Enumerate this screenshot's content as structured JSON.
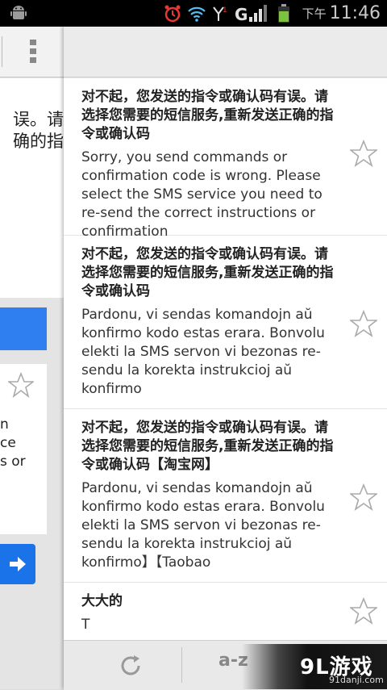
{
  "status_bar": {
    "carrier_lang": "下午",
    "time": "11:46",
    "icons": [
      "android-icon",
      "alarm-icon",
      "wifi-icon",
      "signal-icon",
      "g-signal-icon",
      "battery-icon"
    ]
  },
  "left_panel": {
    "text_lines": [
      "误。请",
      "确的指"
    ],
    "english_lines": [
      "n",
      "ce",
      "s or"
    ]
  },
  "messages": [
    {
      "zh": "对不起，您发送的指令或确认码有误。请选择您需要的短信服务,重新发送正确的指令或确认码",
      "en": "Sorry, you send commands or confirmation code is wrong. Please select the SMS service you need to re-send the correct instructions or confirmation"
    },
    {
      "zh": "对不起，您发送的指令或确认码有误。请选择您需要的短信服务,重新发送正确的指令或确认码",
      "en": "Pardonu, vi sendas komandojn aŭ konfirmo kodo estas erara. Bonvolu elekti la SMS servon vi bezonas re-sendu la korekta instrukcioj aŭ konfirmo"
    },
    {
      "zh": "对不起，您发送的指令或确认码有误。请选择您需要的短信服务,重新发送正确的指令或确认码【淘宝网】",
      "en": "Pardonu, vi sendas komandojn aŭ konfirmo kodo estas erara. Bonvolu elekti la SMS servon vi bezonas re-sendu la korekta instrukcioj aŭ konfirmo】【Taobao"
    },
    {
      "zh": "大大的",
      "en": "T"
    }
  ],
  "bottom_bar": {
    "sort_label": "a-z"
  },
  "watermark": {
    "logo": "9L游戏",
    "site": "91danji.com"
  }
}
